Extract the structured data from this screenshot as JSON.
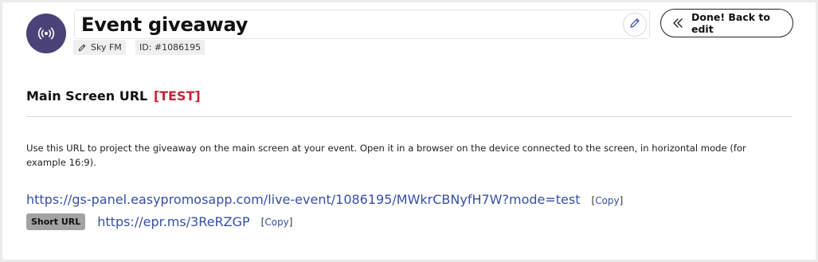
{
  "header": {
    "title": "Event giveaway",
    "author": "Sky FM",
    "id_label": "ID: #1086195",
    "done_button": "Done! Back to edit",
    "avatar_icon": "broadcast-icon",
    "edit_icon": "pencil-icon"
  },
  "section": {
    "title": "Main Screen URL",
    "test_label": "[TEST]",
    "description": "Use this URL to project the giveaway on the main screen at your event. Open it in a browser on the device connected to the screen, in horizontal mode (for example 16:9)."
  },
  "urls": {
    "main_url": "https://gs-panel.easypromosapp.com/live-event/1086195/MWkrCBNyfH7W?mode=test",
    "copy_open": "[",
    "copy_label": "Copy",
    "copy_close": "]",
    "short_badge": "Short URL",
    "short_url": "https://epr.ms/3ReRZGP"
  },
  "colors": {
    "avatar_bg": "#4b4277",
    "test_red": "#c8243a",
    "link_blue": "#3550a6",
    "badge_gray": "#a3a3a3"
  }
}
